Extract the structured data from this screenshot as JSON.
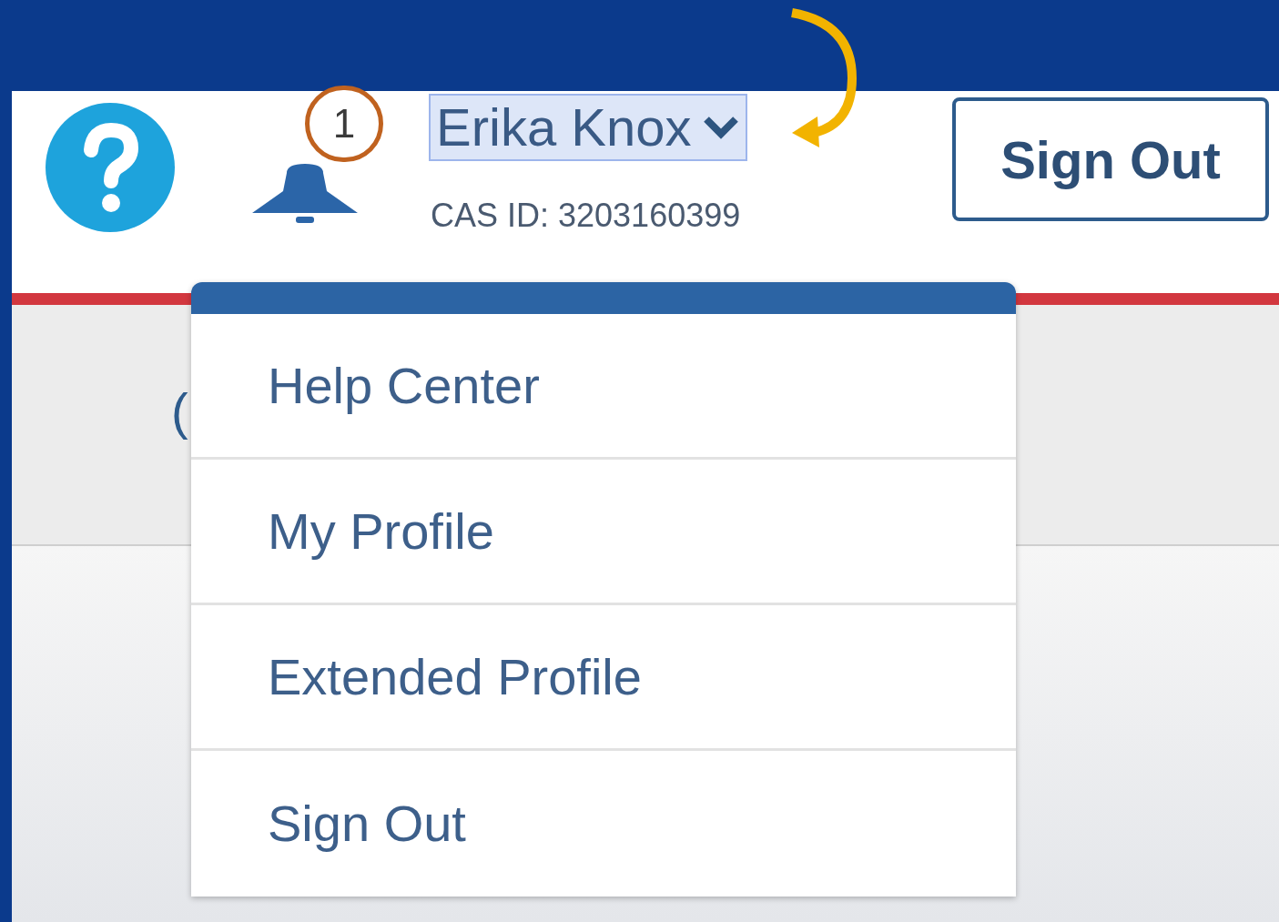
{
  "header": {
    "notifications": {
      "count": "1"
    },
    "user": {
      "name": "Erika Knox",
      "focused": true,
      "cas_id": "CAS ID: 3203160399"
    },
    "sign_out_button": "Sign Out"
  },
  "partial_text": "(",
  "user_menu": {
    "open": true,
    "items": [
      {
        "label": "Help Center"
      },
      {
        "label": "My Profile"
      },
      {
        "label": "Extended Profile"
      },
      {
        "label": "Sign Out"
      }
    ]
  }
}
